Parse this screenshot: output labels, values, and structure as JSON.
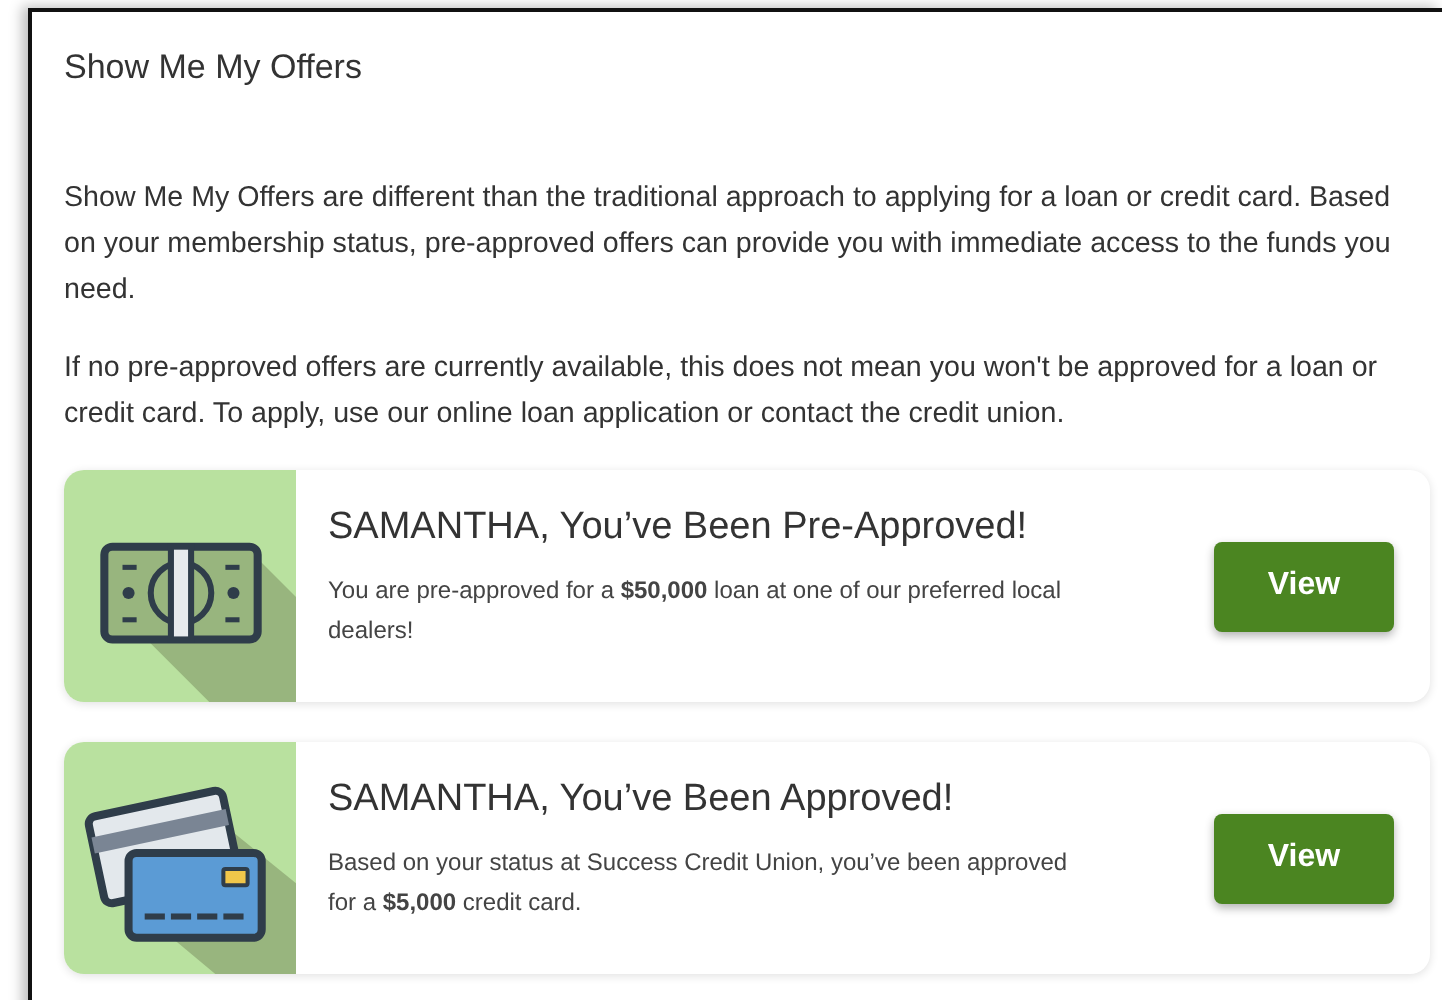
{
  "panel": {
    "title": "Show Me My Offers"
  },
  "paragraphs": [
    "Show Me My Offers are different than the traditional approach to applying for a loan or credit card. Based on your membership status, pre-approved offers can provide you with immediate access to the funds you need.",
    "If no pre-approved offers are currently available, this does not mean you won't be approved for a loan or credit card. To apply, use our online loan application or contact the credit union."
  ],
  "offers": [
    {
      "kind": "cash",
      "title": "SAMANTHA, You’ve Been Pre-Approved!",
      "text": "You are pre-approved for a **$50,000** loan at one of our preferred local dealers!",
      "button": "View"
    },
    {
      "kind": "card",
      "title": "SAMANTHA, You’ve Been Approved!",
      "text": "Based on your status at Success Credit Union, you’ve been approved for a **$5,000** credit card.",
      "button": "View"
    }
  ]
}
